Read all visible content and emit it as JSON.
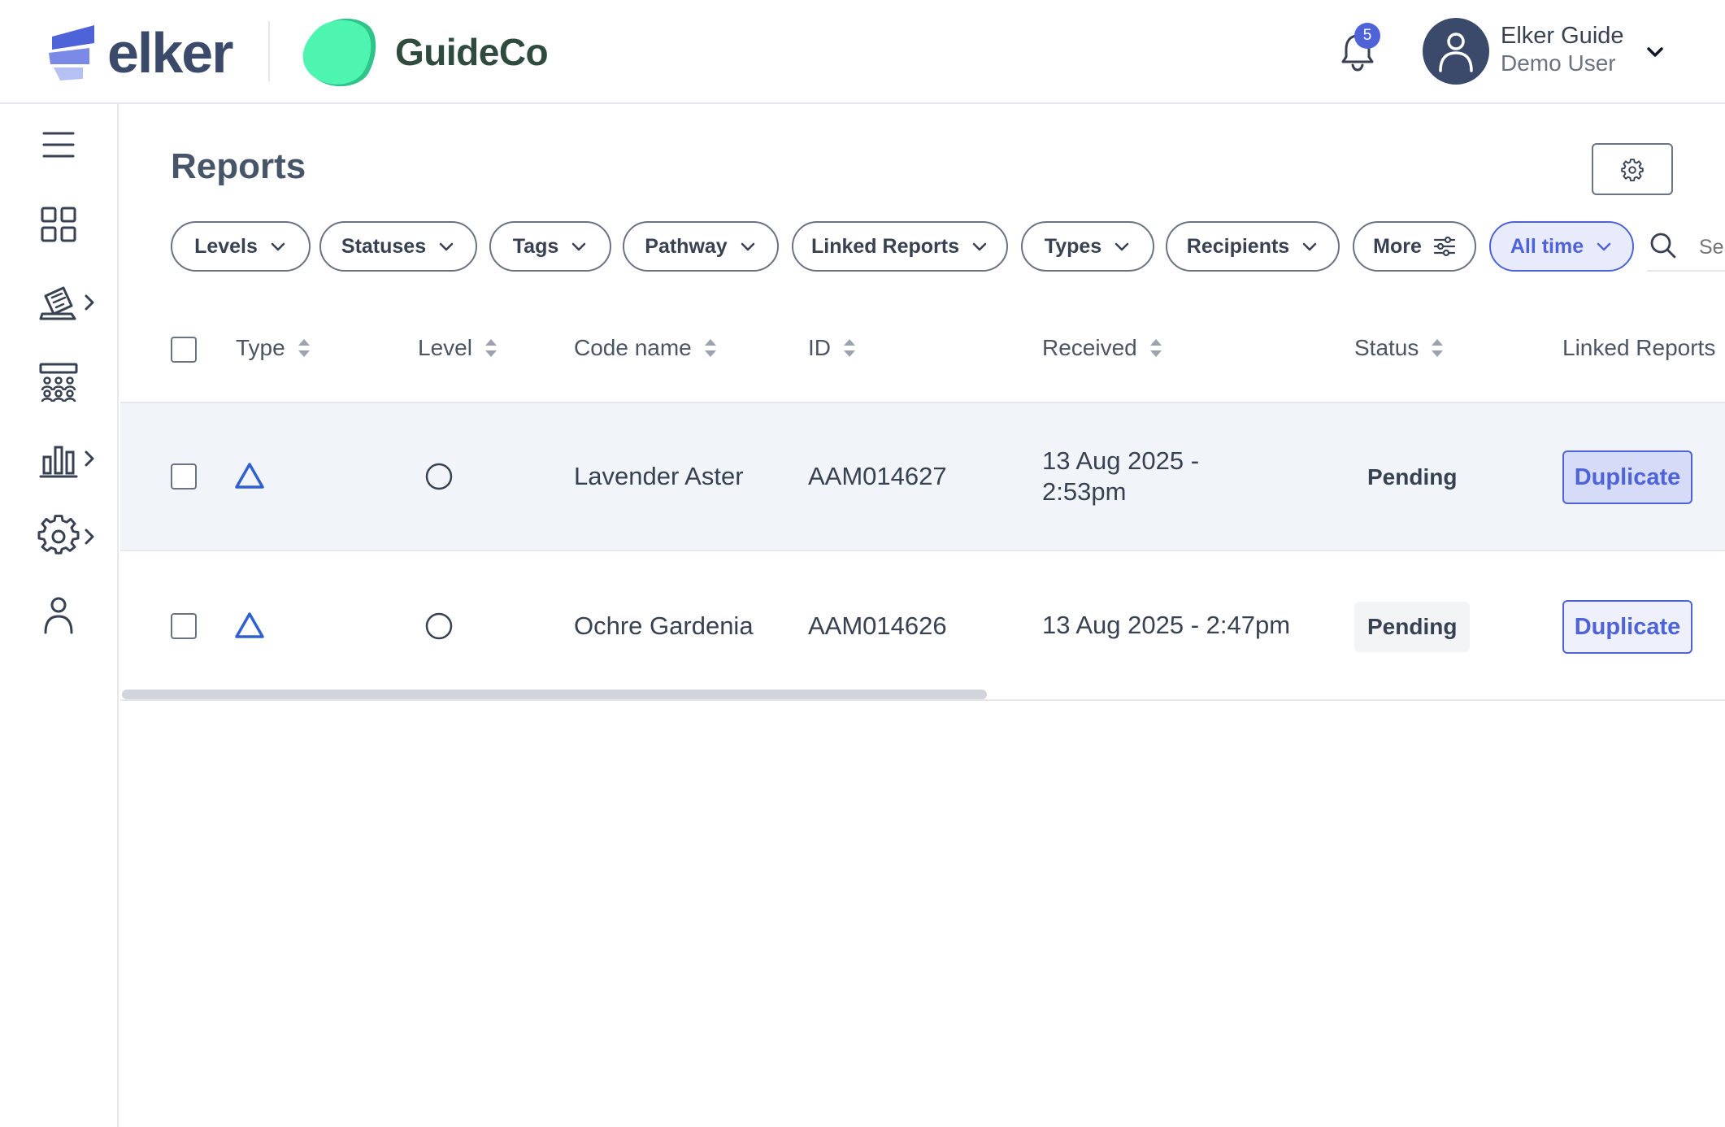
{
  "header": {
    "brand_name": "elker",
    "org_name": "GuideCo",
    "notifications_count": "5",
    "user_name": "Elker Guide",
    "user_role": "Demo User"
  },
  "sidebar": {
    "items": [
      {
        "icon": "menu-icon"
      },
      {
        "icon": "dashboard-grid-icon"
      },
      {
        "icon": "reports-icon",
        "has_submenu": true
      },
      {
        "icon": "teams-icon"
      },
      {
        "icon": "analytics-icon",
        "has_submenu": true
      },
      {
        "icon": "settings-gear-icon",
        "has_submenu": true
      },
      {
        "icon": "profile-icon"
      }
    ]
  },
  "page": {
    "title": "Reports"
  },
  "filters": [
    {
      "label": "Levels"
    },
    {
      "label": "Statuses"
    },
    {
      "label": "Tags"
    },
    {
      "label": "Pathway"
    },
    {
      "label": "Linked Reports"
    },
    {
      "label": "Types"
    },
    {
      "label": "Recipients"
    },
    {
      "label": "More"
    },
    {
      "label": "All time",
      "active": true
    }
  ],
  "search": {
    "placeholder": "Search"
  },
  "table": {
    "columns": [
      "Type",
      "Level",
      "Code name",
      "ID",
      "Received",
      "Status",
      "Linked Reports"
    ],
    "rows": [
      {
        "code_name": "Lavender Aster",
        "id": "AAM014627",
        "received_line1": "13 Aug 2025 -",
        "received_line2": "2:53pm",
        "status": "Pending",
        "linked": "Duplicate"
      },
      {
        "code_name": "Ochre Gardenia",
        "id": "AAM014626",
        "received_line1": "13 Aug 2025 - 2:47pm",
        "received_line2": "",
        "status": "Pending",
        "linked": "Duplicate"
      }
    ]
  },
  "colors": {
    "accent": "#4f63d9",
    "brand_dark": "#3b4a6b",
    "guide_green": "#4ef5b0",
    "row_highlight": "#f1f5f9"
  }
}
